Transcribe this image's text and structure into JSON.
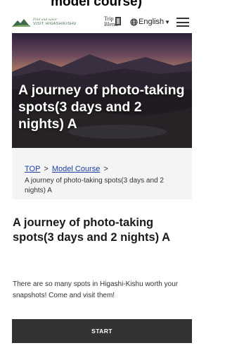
{
  "caption": "model course)",
  "header": {
    "logo_tagline": "Find and savor",
    "logo_name": "VISIT HIGASHIKISHU",
    "trip_blend": "Trip Blend",
    "language": "English",
    "icons": [
      "mountain-logo-icon",
      "globe-icon",
      "caret-down-icon",
      "hamburger-menu-icon"
    ]
  },
  "hero": {
    "title": "A journey of photo-taking spots(3 days and 2 nights) A"
  },
  "breadcrumb": {
    "top": "TOP",
    "separator": ">",
    "model_course": "Model Course",
    "current": "A journey of photo-taking spots(3 days and 2 nights) A"
  },
  "main": {
    "title": "A journey of photo-taking spots(3 days and 2 nights) A",
    "lead": "There are so many spots in Higashi-Kishu worth your snapshots! Come and visit them!",
    "start_label": "START"
  },
  "colors": {
    "breadcrumb_bg": "#f4f4f4",
    "link": "#1a3fa8",
    "start_button_bg": "#333333",
    "logo_green": "#3d6b4a"
  }
}
